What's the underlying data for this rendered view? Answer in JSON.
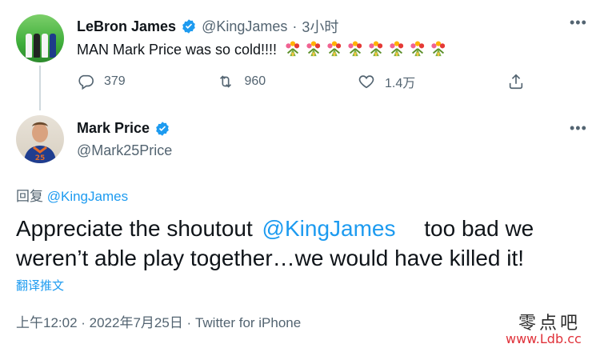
{
  "tweet1": {
    "name": "LeBron James",
    "handle": "@KingJames",
    "sep": "·",
    "time": "3小时",
    "text": "MAN Mark Price was so cold!!!!",
    "emoji_count": 8,
    "emoji_icon": "bouquet-icon",
    "actions": {
      "replies": "379",
      "retweets": "960",
      "likes": "1.4万"
    }
  },
  "tweet2": {
    "name": "Mark Price",
    "handle": "@Mark25Price",
    "reply_prefix": "回复",
    "reply_mention": "@KingJames",
    "text_before": "Appreciate the shoutout",
    "text_mention": "@KingJames",
    "text_after": "too bad we",
    "text_line2": "weren’t able play together…we would have killed it!",
    "translate": "翻译推文",
    "meta": "上午12:02 · 2022年7月25日 · Twitter for iPhone"
  },
  "watermark": {
    "chinese": "零点吧",
    "url": "www.Ldb.cc"
  },
  "colors": {
    "accent": "#1d9bf0",
    "secondary_text": "#536471",
    "primary_text": "#0f1419",
    "divider": "#cfd9de"
  }
}
